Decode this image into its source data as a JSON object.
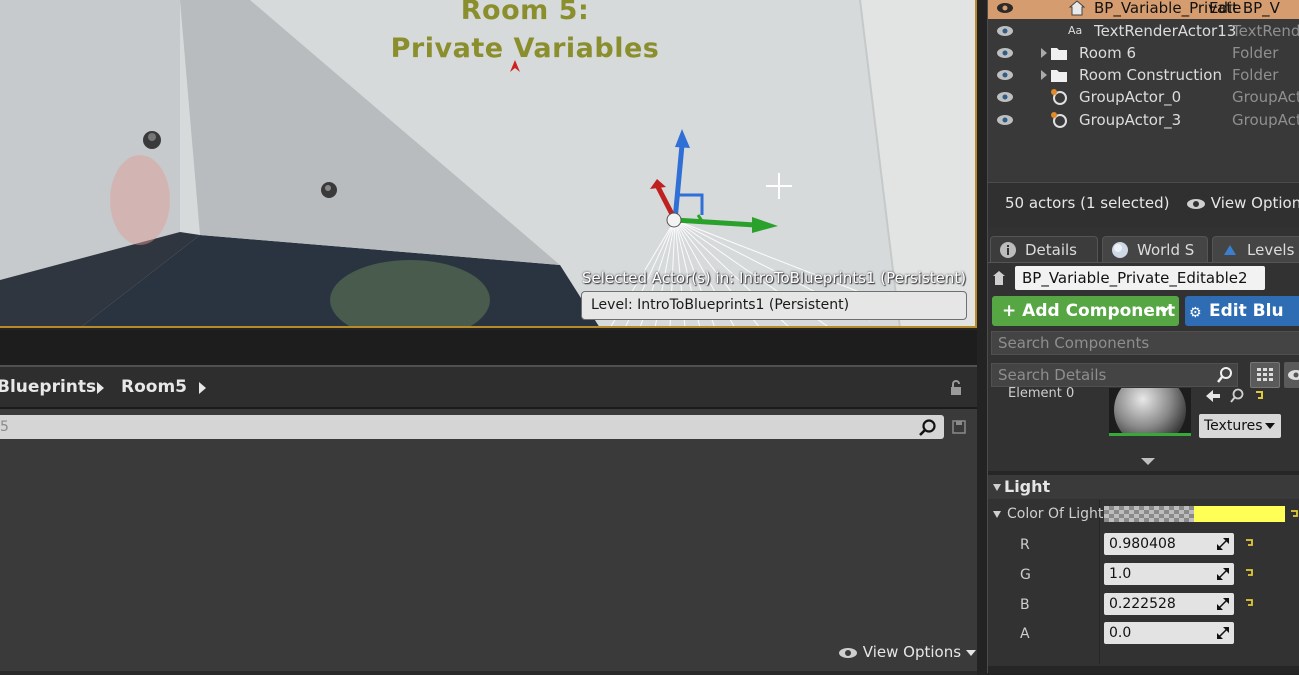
{
  "viewport": {
    "room_title_line1": "Room 5:",
    "room_title_line2": "Private Variables",
    "selected_caption": "Selected Actor(s) in:  IntroToBlueprints1 (Persistent)",
    "level_label": "Level:  IntroToBlueprints1 (Persistent)"
  },
  "content_browser": {
    "breadcrumbs": [
      "Blueprints",
      "Room5"
    ],
    "search_value": "5",
    "view_options": "View Options"
  },
  "outliner": {
    "rows": [
      {
        "name": "BP_Variable_Private",
        "type": "Edit BP_V",
        "icon": "blueprint-house-icon",
        "selected": true
      },
      {
        "name": "TextRenderActor13",
        "type": "TextRend",
        "icon": "text-render-icon",
        "selected": false
      },
      {
        "name": "Room 6",
        "type": "Folder",
        "icon": "folder-icon",
        "selected": false
      },
      {
        "name": "Room Construction",
        "type": "Folder",
        "icon": "folder-icon",
        "selected": false
      },
      {
        "name": "GroupActor_0",
        "type": "GroupActo",
        "icon": "group-actor-icon",
        "selected": false
      },
      {
        "name": "GroupActor_3",
        "type": "GroupActo",
        "icon": "group-actor-icon",
        "selected": false
      }
    ],
    "actor_count": "50 actors (1 selected)",
    "view_options": "View Options"
  },
  "details": {
    "tabs": [
      {
        "label": "Details",
        "icon": "info-icon"
      },
      {
        "label": "World S",
        "icon": "globe-icon"
      },
      {
        "label": "Levels",
        "icon": "levels-icon"
      }
    ],
    "actor_name": "BP_Variable_Private_Editable2",
    "add_component": "+ Add Component",
    "edit_blueprint": "Edit Blu",
    "search_components_placeholder": "Search Components",
    "search_details_placeholder": "Search Details",
    "element0_label": "Element 0",
    "textures_button": "Textures",
    "light_section": "Light",
    "color_of_light_label": "Color Of Light",
    "color_of_light_hex": "#ffff55",
    "channels": [
      {
        "label": "R",
        "value": "0.980408"
      },
      {
        "label": "G",
        "value": "1.0"
      },
      {
        "label": "B",
        "value": "0.222528"
      },
      {
        "label": "A",
        "value": "0.0"
      }
    ]
  },
  "colors": {
    "selection": "#d59d6f",
    "add_component_green": "#57a644",
    "edit_blueprint_blue": "#2e6db3",
    "viewport_border": "#b78a2a",
    "light_color": "#ffff55"
  }
}
